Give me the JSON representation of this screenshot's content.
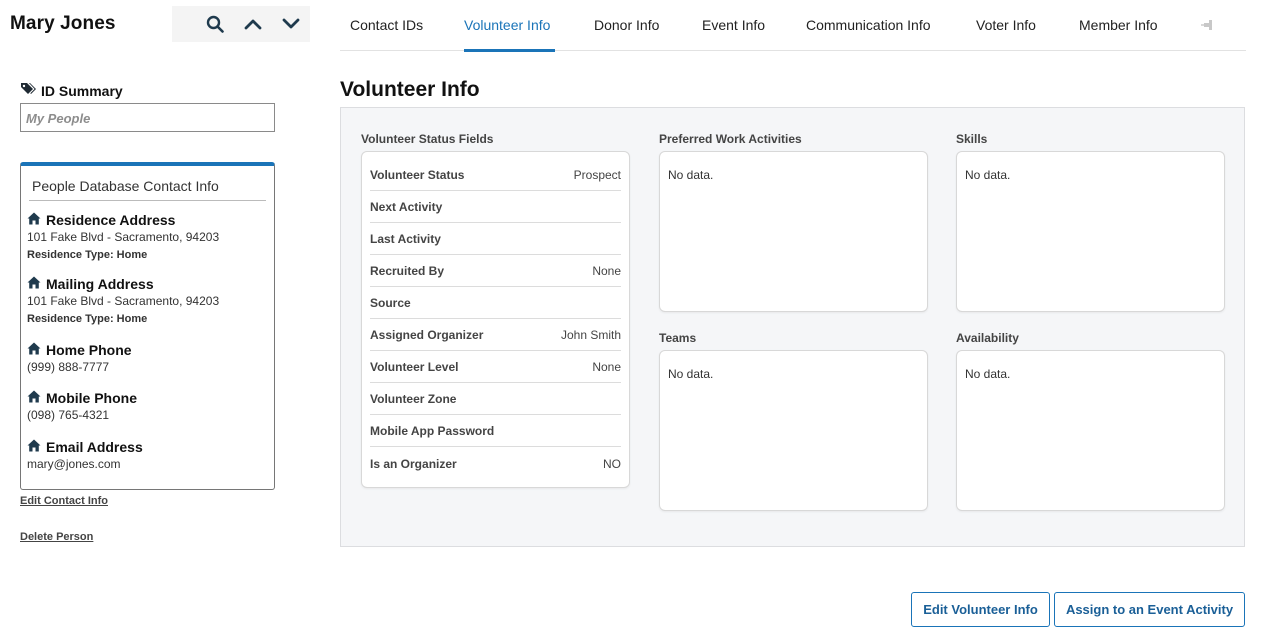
{
  "person": {
    "name": "Mary Jones"
  },
  "nav_tools": {
    "search_icon": "search-icon",
    "prev_icon": "chevron-up-icon",
    "next_icon": "chevron-down-icon"
  },
  "tabs": [
    {
      "label": "Contact IDs"
    },
    {
      "label": "Volunteer Info"
    },
    {
      "label": "Donor Info"
    },
    {
      "label": "Event Info"
    },
    {
      "label": "Communication Info"
    },
    {
      "label": "Voter Info"
    },
    {
      "label": "Member Info"
    }
  ],
  "active_tab": "Volunteer Info",
  "colors": {
    "accent": "#1a74b8",
    "icon_dark": "#1f3a4d",
    "panel_bg": "#f5f6f8"
  },
  "sidebar": {
    "id_summary_title": "ID Summary",
    "my_people_placeholder": "My People",
    "card_title": "People Database Contact Info",
    "blocks": [
      {
        "title": "Residence Address",
        "line": "101 Fake Blvd - Sacramento, 94203",
        "type": "Residence Type: Home"
      },
      {
        "title": "Mailing Address",
        "line": "101 Fake Blvd - Sacramento, 94203",
        "type": "Residence Type: Home"
      },
      {
        "title": "Home Phone",
        "line": "(999) 888-7777"
      },
      {
        "title": "Mobile Phone",
        "line": "(098) 765-4321"
      },
      {
        "title": "Email Address",
        "line": "mary@jones.com"
      }
    ],
    "edit_contact_label": "Edit Contact Info",
    "delete_person_label": "Delete Person"
  },
  "main": {
    "title": "Volunteer Info",
    "status_fields_label": "Volunteer Status Fields",
    "status_fields": [
      {
        "key": "Volunteer Status",
        "value": "Prospect"
      },
      {
        "key": "Next Activity",
        "value": ""
      },
      {
        "key": "Last Activity",
        "value": ""
      },
      {
        "key": "Recruited By",
        "value": "None"
      },
      {
        "key": "Source",
        "value": ""
      },
      {
        "key": "Assigned Organizer",
        "value": "John Smith"
      },
      {
        "key": "Volunteer Level",
        "value": "None"
      },
      {
        "key": "Volunteer Zone",
        "value": ""
      },
      {
        "key": "Mobile App Password",
        "value": ""
      },
      {
        "key": "Is an Organizer",
        "value": "NO"
      }
    ],
    "boxes": {
      "preferred_work": {
        "label": "Preferred Work Activities",
        "content": "No data."
      },
      "skills": {
        "label": "Skills",
        "content": "No data."
      },
      "teams": {
        "label": "Teams",
        "content": "No data."
      },
      "availability": {
        "label": "Availability",
        "content": "No data."
      }
    }
  },
  "buttons": {
    "edit_volunteer": "Edit Volunteer Info",
    "assign_event": "Assign to an Event Activity"
  }
}
